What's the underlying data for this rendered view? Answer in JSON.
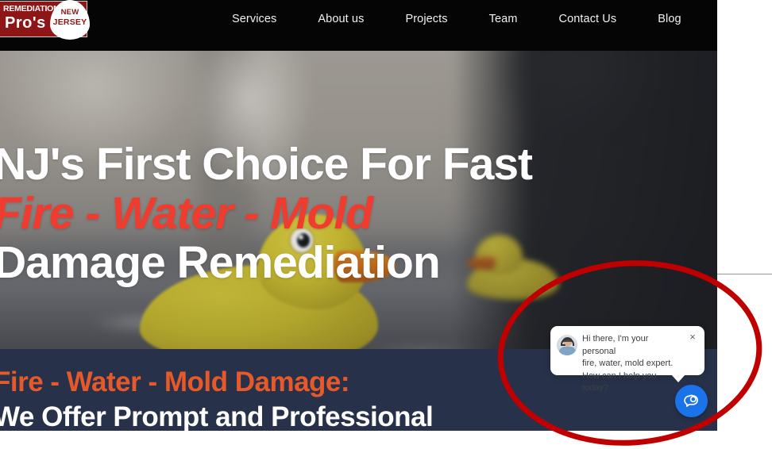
{
  "header": {
    "logo": {
      "line1": "Remediation",
      "line2": "Pro's",
      "badge_line1": "New",
      "badge_line2": "Jersey",
      "plate_color": "#8e1616",
      "bar_color": "#050505"
    },
    "nav": [
      {
        "label": "Services"
      },
      {
        "label": "About us"
      },
      {
        "label": "Projects"
      },
      {
        "label": "Team"
      },
      {
        "label": "Contact Us"
      },
      {
        "label": "Blog"
      }
    ]
  },
  "hero": {
    "line1": "NJ's First Choice For Fast",
    "line2": "Fire - Water - Mold",
    "line3": "Damage Remediation",
    "accent_color": "#f03c2e",
    "text_color": "#ffffff",
    "background_description": "blurred photo of yellow rubber ducks floating on flooded room water"
  },
  "band": {
    "title": "Fire - Water - Mold Damage:",
    "subtitle": "We Offer Prompt and Professional",
    "background_color": "#27324a",
    "title_color": "#e8592a",
    "subtitle_color": "#ffffff"
  },
  "chat": {
    "message_line1": "Hi there, I'm your personal",
    "message_line2": "fire, water, mold expert.",
    "message_line3": "How can I help you today?",
    "close_label": "×",
    "avatar_alt": "support-agent-with-headset",
    "fab_icon": "chat-bubble-icon",
    "fab_color": "#1a73e8"
  },
  "annotation": {
    "shape": "ellipse",
    "color": "#c00000",
    "stroke_width": 7,
    "target": "chat widget"
  }
}
